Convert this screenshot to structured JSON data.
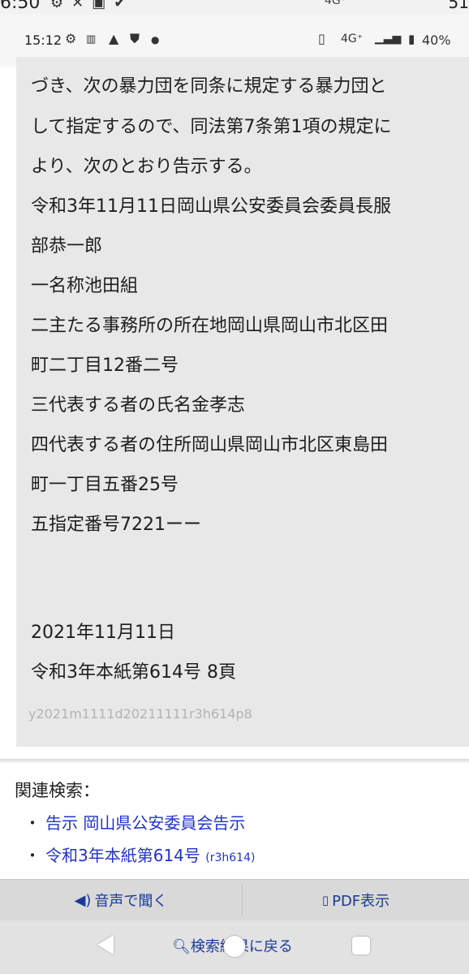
{
  "outer_status": {
    "time": "6:50",
    "network": "4G⁺",
    "battery": "51"
  },
  "status_bar": {
    "time": "15:12",
    "network": "4G⁺",
    "battery": "40%"
  },
  "article": {
    "lines": [
      "づき、次の暴力団を同条に規定する暴力団と",
      "して指定するので、同法第7条第1項の規定に",
      "より、次のとおり告示する。",
      "令和3年11月11日岡山県公安委員会委員長服",
      "部恭一郎",
      "一名称池田組",
      "二主たる事務所の所在地岡山県岡山市北区田",
      "町二丁目12番二号",
      "三代表する者の氏名金孝志",
      "四代表する者の住所岡山県岡山市北区東島田",
      "町一丁目五番25号",
      "五指定番号7221ーー"
    ],
    "date": "2021年11月11日",
    "issue": "令和3年本紙第614号 8頁",
    "code": "y2021m1111d20211111r3h614p8"
  },
  "related": {
    "title": "関連検索：",
    "items": [
      {
        "label": "告示 岡山県公安委員会告示",
        "extra": ""
      },
      {
        "label": "令和3年本紙第614号",
        "extra": "(r3h614)"
      }
    ]
  },
  "toolbar": {
    "audio_label": "音声で聞く",
    "pdf_label": "PDF表示",
    "search_back_label": "検索結果に戻る"
  },
  "colors": {
    "link": "#2233cc",
    "card_bg": "#e8e8e8",
    "toolbar_text": "#1a3a99"
  }
}
